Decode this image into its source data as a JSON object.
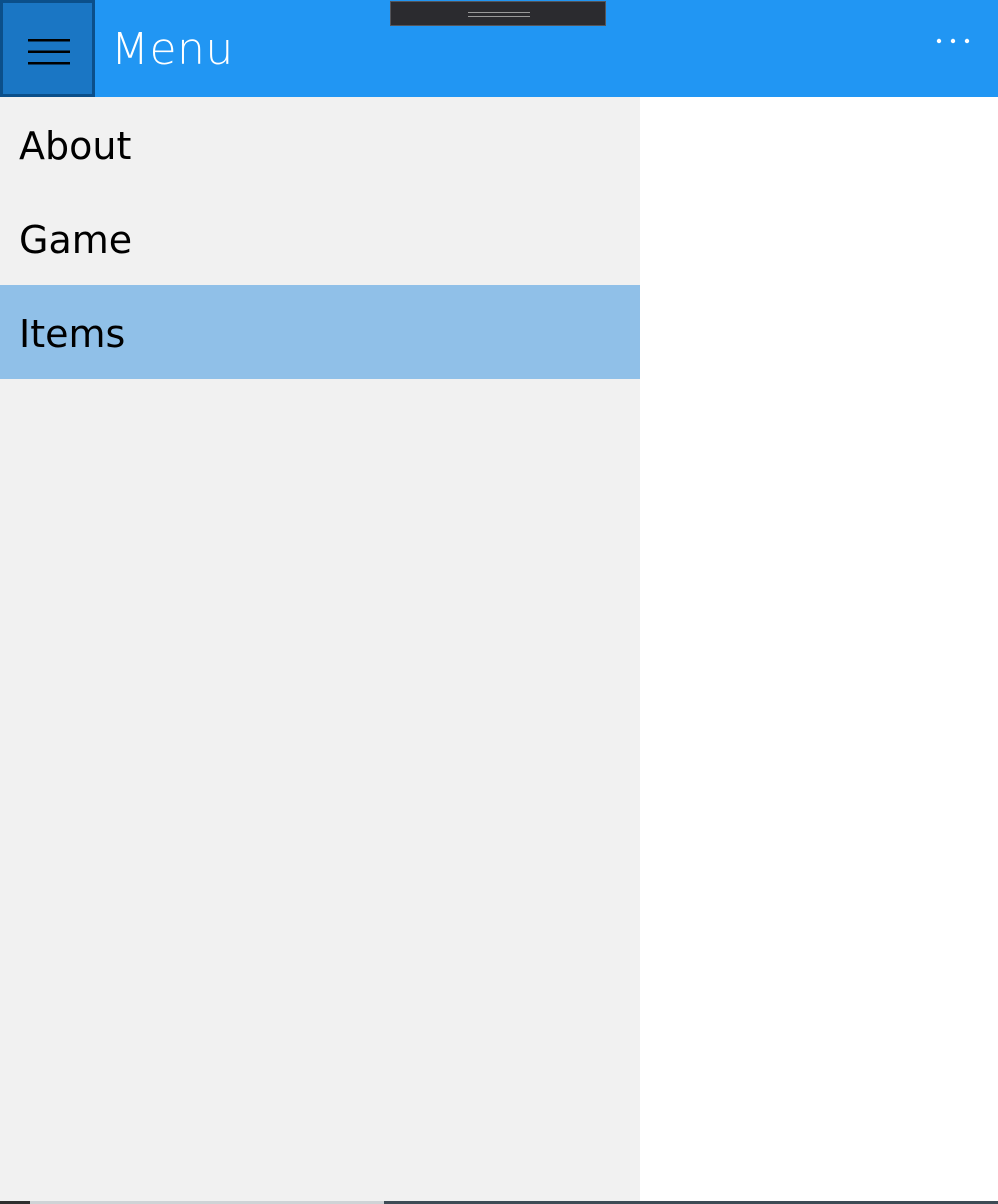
{
  "header": {
    "title": "Menu",
    "accent_color": "#2196f3",
    "hamburger_icon": "hamburger-menu-icon",
    "more_icon": "more-horizontal-icon"
  },
  "sidebar": {
    "items": [
      {
        "label": "About",
        "selected": false
      },
      {
        "label": "Game",
        "selected": false
      },
      {
        "label": "Items",
        "selected": true
      }
    ],
    "selected_color": "#90c0e8",
    "background_color": "#f1f1f1"
  }
}
